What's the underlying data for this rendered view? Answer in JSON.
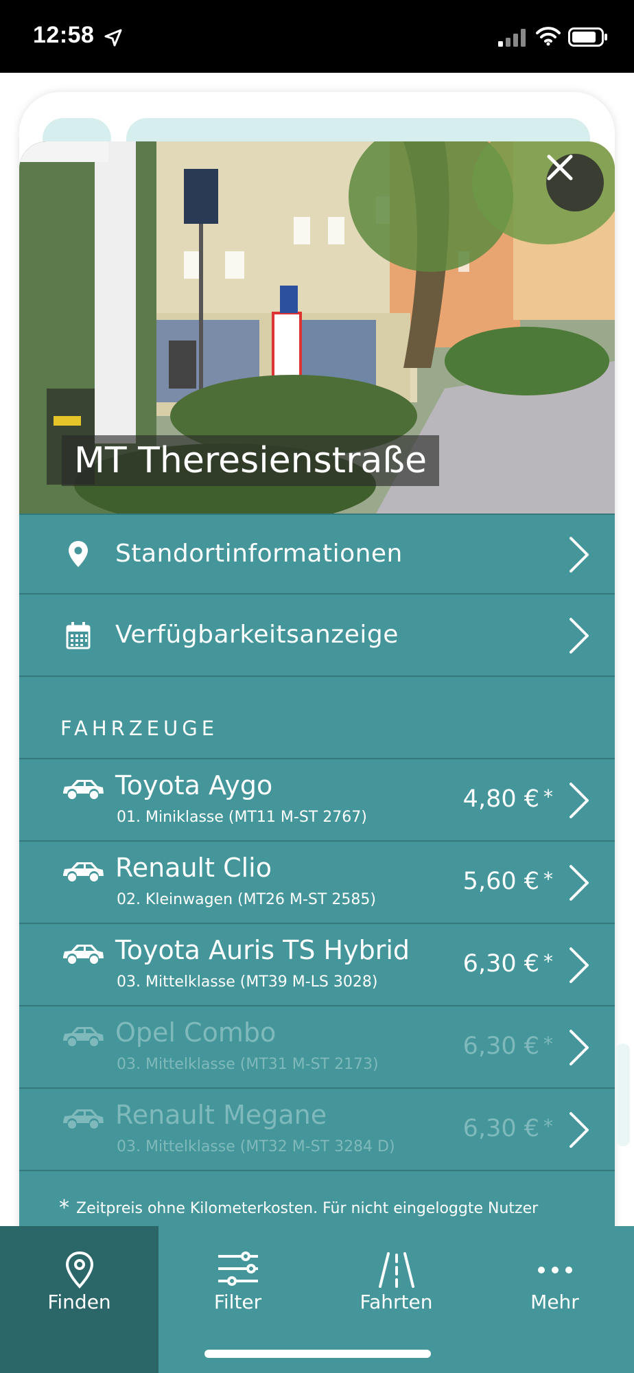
{
  "status_bar": {
    "time": "12:58"
  },
  "station": {
    "name": "MT Theresienstraße"
  },
  "menu": [
    {
      "label": "Standortinformationen",
      "icon": "location-pin-icon"
    },
    {
      "label": "Verfügbarkeitsanzeige",
      "icon": "calendar-icon"
    }
  ],
  "vehicles_section": {
    "title": "FAHRZEUGE",
    "items": [
      {
        "name": "Toyota Aygo",
        "detail": "01. Miniklasse (MT11 M-ST 2767)",
        "price": "4,80 €",
        "asterisk": "*",
        "available": true
      },
      {
        "name": "Renault Clio",
        "detail": "02. Kleinwagen (MT26 M-ST 2585)",
        "price": "5,60 €",
        "asterisk": "*",
        "available": true
      },
      {
        "name": "Toyota Auris TS Hybrid",
        "detail": "03. Mittelklasse (MT39 M-LS 3028)",
        "price": "6,30 €",
        "asterisk": "*",
        "available": true
      },
      {
        "name": "Opel Combo",
        "detail": "03. Mittelklasse (MT31 M-ST 2173)",
        "price": "6,30 €",
        "asterisk": "*",
        "available": false
      },
      {
        "name": "Renault Megane",
        "detail": "03. Mittelklasse (MT32 M-ST 3284 D)",
        "price": "6,30 €",
        "asterisk": "*",
        "available": false
      }
    ]
  },
  "footnote": {
    "asterisk": "*",
    "text": "Zeitpreis ohne Kilometerkosten. Für nicht eingeloggte Nutzer"
  },
  "tabs": [
    {
      "label": "Finden",
      "icon": "map-pin-icon",
      "active": true
    },
    {
      "label": "Filter",
      "icon": "sliders-icon",
      "active": false
    },
    {
      "label": "Fahrten",
      "icon": "road-icon",
      "active": false
    },
    {
      "label": "Mehr",
      "icon": "more-dots-icon",
      "active": false
    }
  ],
  "colors": {
    "teal": "#44969a",
    "teal_dark": "#2b6668",
    "divider": "#33787b",
    "dimmed_text": "#7fb9bb"
  }
}
